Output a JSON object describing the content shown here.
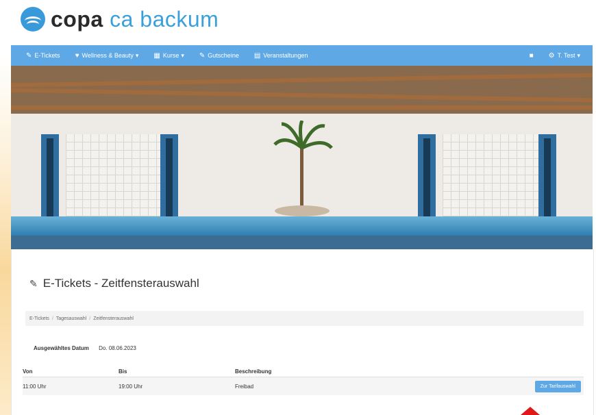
{
  "brand": {
    "word1": "copa",
    "word2": "ca backum"
  },
  "nav": {
    "items": [
      {
        "icon": "ticket-icon",
        "label": "E-Tickets"
      },
      {
        "icon": "heart-icon",
        "label": "Wellness & Beauty"
      },
      {
        "icon": "grid-icon",
        "label": "Kurse"
      },
      {
        "icon": "tag-icon",
        "label": "Gutscheine"
      },
      {
        "icon": "calendar-icon",
        "label": "Veranstaltungen"
      }
    ],
    "cart_icon": "cart-icon",
    "user_label": "T. Test"
  },
  "page": {
    "title": "E-Tickets - Zeitfensterauswahl",
    "breadcrumb": [
      "E-Tickets",
      "Tagesauswahl",
      "Zeitfensterauswahl"
    ],
    "selected_date_label": "Ausgewähltes Datum",
    "selected_date_value": "Do. 08.06.2023"
  },
  "table": {
    "headers": [
      "Von",
      "Bis",
      "Beschreibung"
    ],
    "rows": [
      {
        "from": "11:00 Uhr",
        "to": "19:00 Uhr",
        "description": "Freibad",
        "action": "Zur Tarifauswahl"
      }
    ]
  },
  "colors": {
    "accent": "#5ea8e6",
    "band": "#3d6c93",
    "arrow": "#e01818"
  }
}
